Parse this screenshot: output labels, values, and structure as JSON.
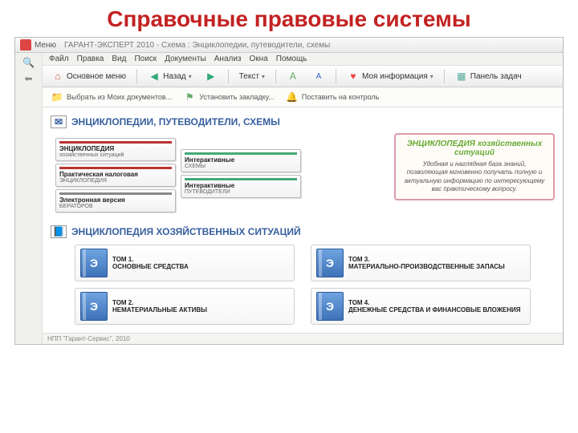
{
  "slide": {
    "title": "Справочные правовые системы"
  },
  "window": {
    "title": "ГАРАНТ-ЭКСПЕРТ 2010 - Схема : Энциклопедии, путеводители, схемы",
    "menu_label": "Меню"
  },
  "menubar": [
    "Файл",
    "Правка",
    "Вид",
    "Поиск",
    "Документы",
    "Анализ",
    "Окна",
    "Помощь"
  ],
  "toolbar": {
    "main_menu": "Основное меню",
    "back": "Назад",
    "text_tool": "Текст",
    "my_info": "Моя информация",
    "panel": "Панель задач"
  },
  "subtoolbar": {
    "put_docs": "Выбрать из Моих документов...",
    "bookmark": "Установить закладку...",
    "control": "Поставить на контроль"
  },
  "section1": {
    "title": "ЭНЦИКЛОПЕДИИ, ПУТЕВОДИТЕЛИ, СХЕМЫ"
  },
  "books_left": [
    {
      "title": "ЭНЦИКЛОПЕДИЯ",
      "sub": "хозяйственных ситуаций"
    },
    {
      "title": "Практическая налоговая",
      "sub": "ЭНЦИКЛОПЕДИЯ"
    },
    {
      "title": "Электронная версия",
      "sub": "БЕРАТОРОВ"
    }
  ],
  "books_right": [
    {
      "title": "Интерактивные",
      "sub": "СХЕМЫ"
    },
    {
      "title": "Интерактивные",
      "sub": "ПУТЕВОДИТЕЛИ"
    }
  ],
  "side_panel": {
    "title": "ЭНЦИКЛОПЕДИЯ хозяйственных ситуаций",
    "body": "Удобная и наглядная база знаний, позволяющая мгновенно получать полную и актуальную информацию по интересующему вас практическому вопросу."
  },
  "section2": {
    "title": "ЭНЦИКЛОПЕДИЯ ХОЗЯЙСТВЕННЫХ СИТУАЦИЙ"
  },
  "toms": [
    {
      "num": "ТОМ 1.",
      "desc": "ОСНОВНЫЕ СРЕДСТВА"
    },
    {
      "num": "ТОМ 3.",
      "desc": "МАТЕРИАЛЬНО-ПРОИЗВОДСТВЕННЫЕ ЗАПАСЫ"
    },
    {
      "num": "ТОМ 2.",
      "desc": "НЕМАТЕРИАЛЬНЫЕ АКТИВЫ"
    },
    {
      "num": "ТОМ 4.",
      "desc": "ДЕНЕЖНЫЕ СРЕДСТВА И ФИНАНСОВЫЕ ВЛОЖЕНИЯ"
    }
  ],
  "footer": "НПП \"Гарант-Сервис\", 2010"
}
